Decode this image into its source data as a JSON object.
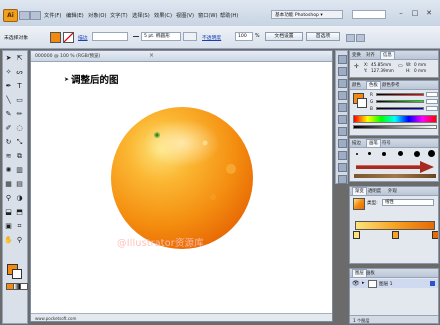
{
  "menubar": {
    "app_logo": "Ai",
    "menus": [
      "文件(F)",
      "编辑(E)",
      "对象(O)",
      "文字(T)",
      "选择(S)",
      "效果(C)",
      "视图(V)",
      "窗口(W)",
      "帮助(H)"
    ],
    "workspace": "基本功能 Photoshop ▾",
    "window_buttons": [
      "–",
      "□",
      "✕"
    ]
  },
  "control_bar": {
    "selection_label": "未选择对象",
    "stroke_label": "描边",
    "stroke_value": "",
    "brush_value": "5 pt. 椭圆形",
    "opacity_label": "不透明度",
    "opacity_value": "100",
    "opacity_unit": "%",
    "doc_setup_button": "文档设置",
    "preferences_button": "首选项"
  },
  "document": {
    "tab_label": "000000 @ 100 % (RGB/预览)",
    "canvas_title": "调整后的图",
    "watermark": "@Illustrator资源库",
    "status_text": "www.pocketsoft.com"
  },
  "colors": {
    "accent_orange": "#f28a12",
    "orange_light": "#fcd15a",
    "orange_dark": "#e76a06",
    "stem_green": "#5b9b2c",
    "arrow_red": "#a62a20"
  },
  "info_panel": {
    "tabs": [
      "变换",
      "对齐",
      "信息"
    ],
    "x_label": "X:",
    "x_value": "45.85mm",
    "y_label": "Y:",
    "y_value": "127.39mm",
    "w_label": "W:",
    "w_value": "0 mm",
    "h_label": "H:",
    "h_value": "0 mm"
  },
  "color_panel": {
    "tabs": [
      "颜色",
      "色板",
      "颜色参考"
    ],
    "channels": [
      {
        "label": "R",
        "value": ""
      },
      {
        "label": "G",
        "value": ""
      },
      {
        "label": "B",
        "value": ""
      }
    ]
  },
  "brush_panel": {
    "tabs": [
      "描边",
      "画笔",
      "符号"
    ]
  },
  "gradient_panel": {
    "tabs": [
      "渐变",
      "透明度",
      "外观"
    ],
    "type_label": "类型:",
    "type_value": "线性"
  },
  "layers_panel": {
    "tabs": [
      "图层",
      "画板"
    ],
    "layer_name": "图层 1",
    "footer": "1 个图层"
  },
  "toolbox": {
    "tool_icons": [
      "selection-tool-icon",
      "direct-selection-tool-icon",
      "magic-wand-tool-icon",
      "lasso-tool-icon",
      "pen-tool-icon",
      "type-tool-icon",
      "line-tool-icon",
      "rectangle-tool-icon",
      "paintbrush-tool-icon",
      "pencil-tool-icon",
      "blob-brush-tool-icon",
      "eraser-tool-icon",
      "rotate-tool-icon",
      "scale-tool-icon",
      "warp-tool-icon",
      "free-transform-tool-icon",
      "symbol-sprayer-tool-icon",
      "column-graph-tool-icon",
      "mesh-tool-icon",
      "gradient-tool-icon",
      "eyedropper-tool-icon",
      "blend-tool-icon",
      "live-paint-tool-icon",
      "live-paint-selection-tool-icon",
      "artboard-tool-icon",
      "slice-tool-icon",
      "hand-tool-icon",
      "zoom-tool-icon"
    ]
  }
}
